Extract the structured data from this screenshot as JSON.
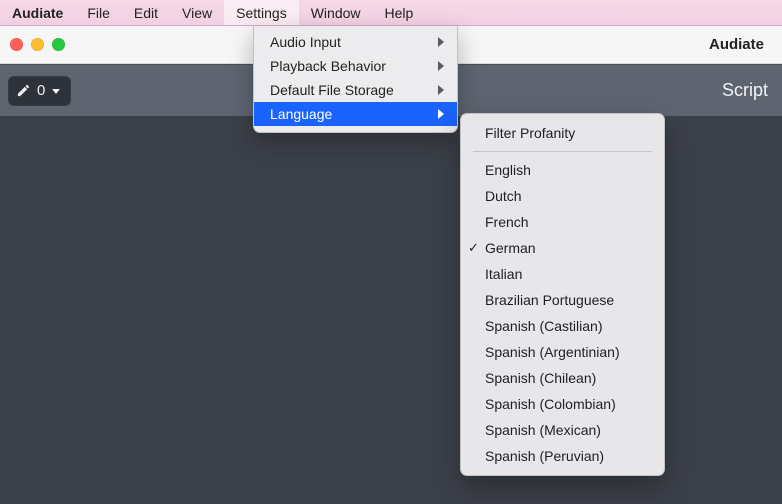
{
  "menubar": {
    "app": "Audiate",
    "items": [
      "File",
      "Edit",
      "View",
      "Settings",
      "Window",
      "Help"
    ],
    "open_index": 3
  },
  "titlebar": {
    "app_title": "Audiate"
  },
  "toolbar": {
    "edit_count": "0",
    "script_label": "Script"
  },
  "settings_menu": {
    "items": [
      {
        "label": "Audio Input",
        "submenu": true
      },
      {
        "label": "Playback Behavior",
        "submenu": true
      },
      {
        "label": "Default File Storage",
        "submenu": true
      },
      {
        "label": "Language",
        "submenu": true,
        "highlighted": true
      }
    ]
  },
  "language_menu": {
    "top_item": "Filter Profanity",
    "languages": [
      "English",
      "Dutch",
      "French",
      "German",
      "Italian",
      "Brazilian Portuguese",
      "Spanish (Castilian)",
      "Spanish (Argentinian)",
      "Spanish (Chilean)",
      "Spanish (Colombian)",
      "Spanish (Mexican)",
      "Spanish (Peruvian)"
    ],
    "checked_index": 3
  }
}
